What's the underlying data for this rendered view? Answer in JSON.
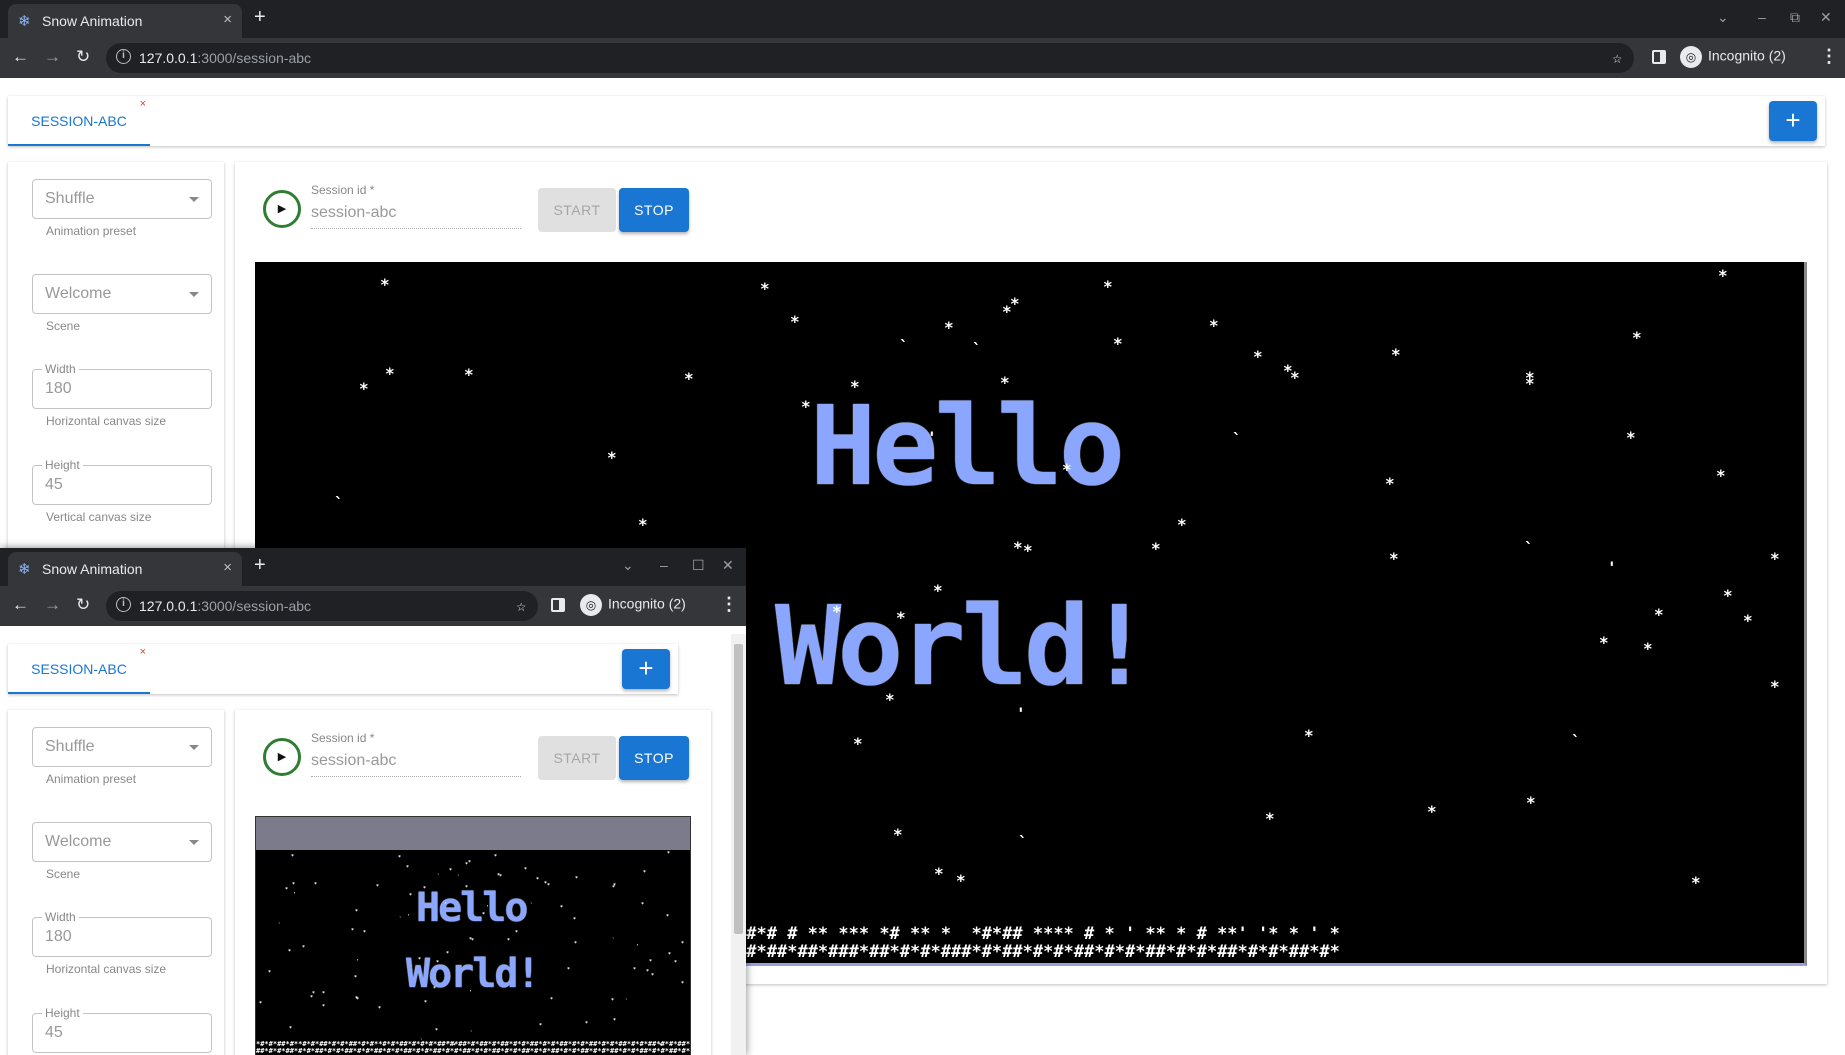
{
  "browser": {
    "tab_title": "Snow Animation",
    "url_host": "127.0.0.1",
    "url_path": ":3000/session-abc",
    "incognito_label": "Incognito (2)"
  },
  "app": {
    "session_tab_label": "SESSION-ABC",
    "add_label": "+",
    "preset": {
      "value": "Shuffle",
      "helper": "Animation preset"
    },
    "scene": {
      "value": "Welcome",
      "helper": "Scene"
    },
    "width": {
      "label": "Width",
      "value": "180",
      "helper": "Horizontal canvas size"
    },
    "height": {
      "label": "Height",
      "value": "45",
      "helper": "Vertical canvas size"
    },
    "session_id": {
      "label": "Session id *",
      "value": "session-abc"
    },
    "start_label": "START",
    "stop_label": "STOP",
    "canvas_text": {
      "line1": "Hello",
      "line2": "World!"
    }
  },
  "icons": {
    "snowflake": "❄",
    "play": "▶",
    "close": "×",
    "info": "i"
  }
}
